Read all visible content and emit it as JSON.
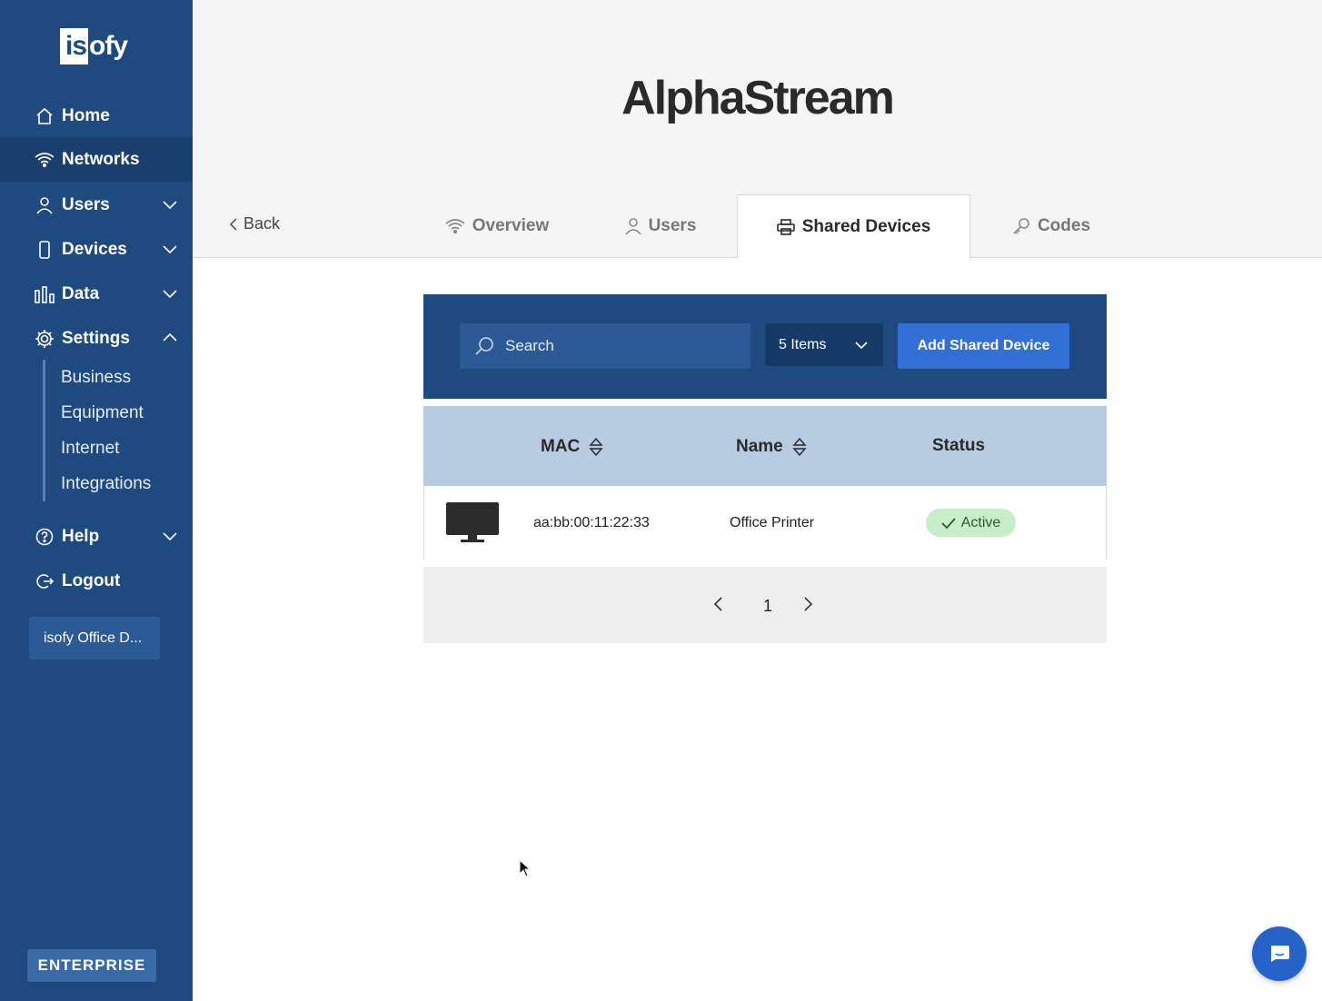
{
  "brand": {
    "logo_box": "is",
    "logo_rest": "ofy"
  },
  "sidebar": {
    "items": [
      {
        "label": "Home",
        "icon": "home-icon"
      },
      {
        "label": "Networks",
        "icon": "wifi-icon",
        "active": true
      },
      {
        "label": "Users",
        "icon": "user-icon"
      },
      {
        "label": "Devices",
        "icon": "phone-icon"
      },
      {
        "label": "Data",
        "icon": "bar-chart-icon"
      },
      {
        "label": "Settings",
        "icon": "gear-icon"
      },
      {
        "label": "Help",
        "icon": "help-circle-icon"
      },
      {
        "label": "Logout",
        "icon": "logout-icon"
      }
    ],
    "settings_sub": [
      "Business",
      "Equipment",
      "Internet",
      "Integrations"
    ],
    "office_button": "isofy Office D...",
    "plan_badge": "ENTERPRISE"
  },
  "header": {
    "title": "AlphaStream",
    "back_label": "Back",
    "tabs": [
      {
        "label": "Overview",
        "icon": "wifi-icon"
      },
      {
        "label": "Users",
        "icon": "user-icon"
      },
      {
        "label": "Shared Devices",
        "icon": "printer-icon",
        "active": true
      },
      {
        "label": "Codes",
        "icon": "key-icon"
      }
    ]
  },
  "toolbar": {
    "search_placeholder": "Search",
    "items_select": "5 Items",
    "add_button": "Add Shared Device"
  },
  "table": {
    "columns": [
      "MAC",
      "Name",
      "Status"
    ],
    "rows": [
      {
        "icon": "monitor-icon",
        "mac": "aa:bb:00:11:22:33",
        "name": "Office Printer",
        "status": "Active"
      }
    ]
  },
  "pagination": {
    "current_page": "1"
  },
  "colors": {
    "sidebar": "#1f4a80",
    "primary_button": "#3270d6",
    "table_header": "#b7cbe1",
    "status_active_bg": "#c7eec8"
  }
}
